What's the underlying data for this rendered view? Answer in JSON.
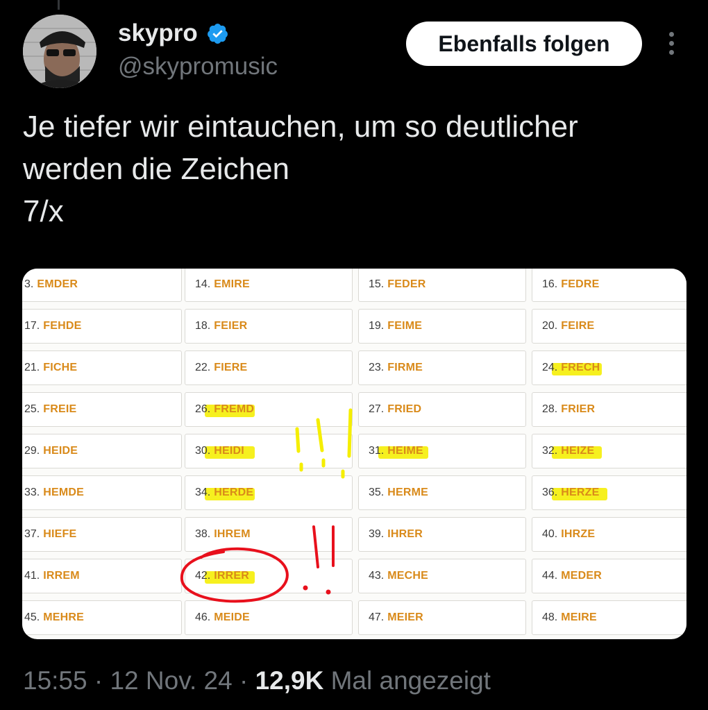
{
  "author": {
    "display_name": "skypro",
    "handle": "@skypromusic"
  },
  "actions": {
    "follow_label": "Ebenfalls folgen"
  },
  "tweet": {
    "text": "Je tiefer wir eintauchen, um so deutlicher\nwerden die Zeichen\n7/x"
  },
  "image_grid": {
    "rows": [
      [
        [
          "3.",
          "EMDER"
        ],
        [
          "14.",
          "EMIRE"
        ],
        [
          "15.",
          "FEDER"
        ],
        [
          "16.",
          "FEDRE"
        ]
      ],
      [
        [
          "17.",
          "FEHDE"
        ],
        [
          "18.",
          "FEIER"
        ],
        [
          "19.",
          "FEIME"
        ],
        [
          "20.",
          "FEIRE"
        ]
      ],
      [
        [
          "21.",
          "FICHE"
        ],
        [
          "22.",
          "FIERE"
        ],
        [
          "23.",
          "FIRME"
        ],
        [
          "24.",
          "FRECH"
        ]
      ],
      [
        [
          "25.",
          "FREIE"
        ],
        [
          "26.",
          "FREMD"
        ],
        [
          "27.",
          "FRIED"
        ],
        [
          "28.",
          "FRIER"
        ]
      ],
      [
        [
          "29.",
          "HEIDE"
        ],
        [
          "30.",
          "HEIDI"
        ],
        [
          "31.",
          "HEIME"
        ],
        [
          "32.",
          "HEIZE"
        ]
      ],
      [
        [
          "33.",
          "HEMDE"
        ],
        [
          "34.",
          "HERDE"
        ],
        [
          "35.",
          "HERME"
        ],
        [
          "36.",
          "HERZE"
        ]
      ],
      [
        [
          "37.",
          "HIEFE"
        ],
        [
          "38.",
          "IHREM"
        ],
        [
          "39.",
          "IHRER"
        ],
        [
          "40.",
          "IHRZE"
        ]
      ],
      [
        [
          "41.",
          "IRREM"
        ],
        [
          "42.",
          "IRRER"
        ],
        [
          "43.",
          "MECHE"
        ],
        [
          "44.",
          "MEDER"
        ]
      ],
      [
        [
          "45.",
          "MEHRE"
        ],
        [
          "46.",
          "MEIDE"
        ],
        [
          "47.",
          "MEIER"
        ],
        [
          "48.",
          "MEIRE"
        ]
      ]
    ],
    "highlighted": [
      "24",
      "26",
      "30",
      "31",
      "32",
      "34",
      "36",
      "42"
    ],
    "highlight_color": "#f5ee00",
    "circled": "42",
    "circle_color": "#e8101c"
  },
  "meta": {
    "time": "15:55",
    "separator": "·",
    "date": "12 Nov. 24",
    "views_count": "12,9K",
    "views_label": "Mal angezeigt"
  },
  "colors": {
    "background": "#000000",
    "text_primary": "#e7e9ea",
    "text_secondary": "#71767b",
    "verified": "#1d9bf0",
    "word_orange": "#d98a1a"
  },
  "icons": {
    "verified": "verified-badge-icon",
    "more": "more-dots-icon"
  }
}
